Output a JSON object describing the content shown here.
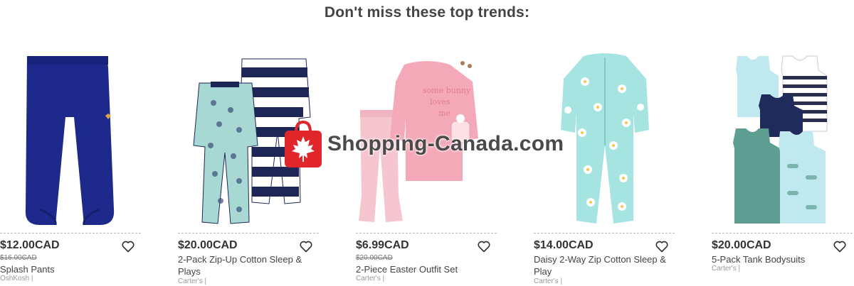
{
  "heading": "Don't miss these top trends:",
  "products": [
    {
      "price": "$12.00CAD",
      "was_price": "$16.00CAD",
      "name": "Splash Pants",
      "brand": "OshKosh |"
    },
    {
      "price": "$20.00CAD",
      "was_price": "",
      "name": "2-Pack Zip-Up Cotton Sleep & Plays",
      "brand": "Carter's |"
    },
    {
      "price": "$6.99CAD",
      "was_price": "$20.00CAD",
      "name": "2-Piece Easter Outfit Set",
      "brand": "Carter's |"
    },
    {
      "price": "$14.00CAD",
      "was_price": "",
      "name": "Daisy 2-Way Zip Cotton Sleep & Play",
      "brand": "Carter's |"
    },
    {
      "price": "$20.00CAD",
      "was_price": "",
      "name": "5-Pack Tank Bodysuits",
      "brand": "Carter's |"
    }
  ],
  "watermark": {
    "text": "Shopping-Canada.com"
  },
  "icons": {
    "favorite": "heart-outline-icon"
  },
  "colors": {
    "text": "#333333",
    "muted": "#999999",
    "watermark_red": "#e0262b"
  }
}
